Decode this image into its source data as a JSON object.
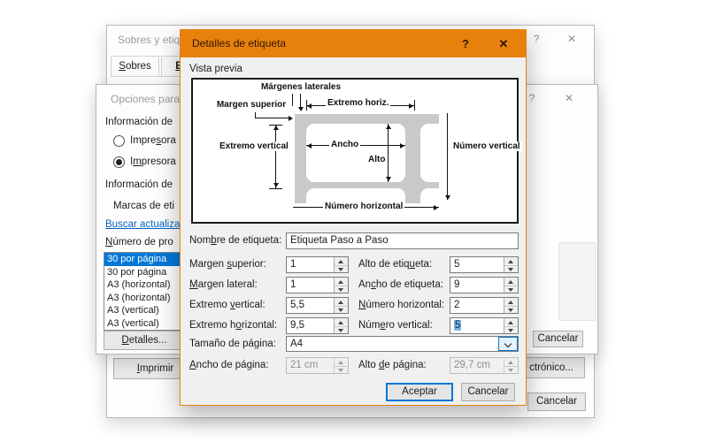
{
  "colors": {
    "accent_orange": "#E8810C",
    "selection_blue": "#0078D7",
    "text_selection_highlight": "#79B7E3",
    "link_blue": "#0563C1"
  },
  "icons": {
    "help": "?",
    "close": "✕"
  },
  "back_dialog": {
    "title": "Sobres y etiqu",
    "tabs": {
      "sobres": {
        "ac": "S",
        "post": "obres"
      },
      "etiquetas": {
        "ac": "E",
        "post": "t"
      }
    },
    "buttons": {
      "imprimir": {
        "ac": "I",
        "post": "mprimir"
      },
      "electronico": "ctrónico...",
      "cancelar": "Cancelar"
    }
  },
  "options_dialog": {
    "title": "Opciones para",
    "info_impresora": "Información de",
    "radio1": {
      "pre": "Impre",
      "ac": "s",
      "post": "ora"
    },
    "radio2": {
      "pre": "I",
      "ac": "m",
      "post": "presora"
    },
    "info_etiquetas": "Información de",
    "marcas": "Marcas de eti",
    "update_link": "Buscar actualiza",
    "numero_producto": {
      "ac": "N",
      "post": "úmero de pro"
    },
    "list_items": {
      "0": "30 por página",
      "1": "30 por página",
      "2": "A3 (horizontal)",
      "3": "A3 (horizontal)",
      "4": "A3 (vertical)",
      "5": "A3 (vertical)"
    },
    "buttons": {
      "detalles": {
        "ac": "D",
        "post": "etalles..."
      },
      "cancelar": "Cancelar"
    }
  },
  "details_dialog": {
    "title": "Detalles de etiqueta",
    "preview_label": "Vista previa",
    "diagram": {
      "margenes_laterales": "Márgenes laterales",
      "margen_superior": "Margen superior",
      "extremo_horiz": "Extremo horiz.",
      "extremo_vertical": "Extremo vertical",
      "ancho": "Ancho",
      "alto": "Alto",
      "numero_vertical": "Número vertical",
      "numero_horizontal": "Número horizontal"
    },
    "fields": {
      "nombre": {
        "label": {
          "pre": "Nom",
          "ac": "b",
          "post": "re de etiqueta:"
        },
        "value": "Etiqueta Paso a Paso"
      },
      "margen_superior": {
        "label": {
          "pre": "Margen ",
          "ac": "s",
          "post": "uperior:"
        },
        "value": "1"
      },
      "alto_etiqueta": {
        "label": {
          "pre": "Alto de etiq",
          "ac": "u",
          "post": "eta:"
        },
        "value": "5"
      },
      "margen_lateral": {
        "label": {
          "pre": "",
          "ac": "M",
          "post": "argen lateral:"
        },
        "value": "1"
      },
      "ancho_etiqueta": {
        "label": {
          "pre": "An",
          "ac": "c",
          "post": "ho de etiqueta:"
        },
        "value": "9"
      },
      "extremo_vertical": {
        "label": {
          "pre": "Extremo ",
          "ac": "v",
          "post": "ertical:"
        },
        "value": "5,5"
      },
      "numero_horizontal": {
        "label": {
          "pre": "",
          "ac": "N",
          "post": "úmero horizontal:"
        },
        "value": "2"
      },
      "extremo_horizontal": {
        "label": {
          "pre": "Extremo h",
          "ac": "o",
          "post": "rizontal:"
        },
        "value": "9,5"
      },
      "numero_vertical": {
        "label": {
          "pre": "Núm",
          "ac": "e",
          "post": "ro vertical:"
        },
        "value": "5"
      },
      "tamano_pagina": {
        "label": {
          "pre": "Tamaño de página:",
          "ac": "",
          "post": ""
        },
        "value": "A4"
      },
      "ancho_pagina": {
        "label": {
          "pre": "",
          "ac": "A",
          "post": "ncho de página:"
        },
        "value": "21 cm"
      },
      "alto_pagina": {
        "label": {
          "pre": "Alto ",
          "ac": "d",
          "post": "e página:"
        },
        "value": "29,7 cm"
      }
    },
    "buttons": {
      "aceptar": "Aceptar",
      "cancelar": "Cancelar"
    }
  }
}
